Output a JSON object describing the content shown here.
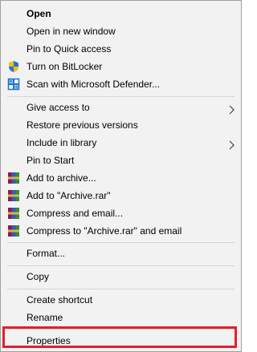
{
  "context_menu": {
    "items": [
      {
        "label": "Open",
        "bold": true
      },
      {
        "label": "Open in new window"
      },
      {
        "label": "Pin to Quick access"
      },
      {
        "label": "Turn on BitLocker",
        "icon": "shield-icon"
      },
      {
        "label": "Scan with Microsoft Defender...",
        "icon": "defender-icon"
      },
      {
        "label": "Give access to",
        "submenu": true
      },
      {
        "label": "Restore previous versions"
      },
      {
        "label": "Include in library",
        "submenu": true
      },
      {
        "label": "Pin to Start"
      },
      {
        "label": "Add to archive...",
        "icon": "winrar-icon"
      },
      {
        "label": "Add to \"Archive.rar\"",
        "icon": "winrar-icon"
      },
      {
        "label": "Compress and email...",
        "icon": "winrar-icon"
      },
      {
        "label": "Compress to \"Archive.rar\" and email",
        "icon": "winrar-icon"
      },
      {
        "label": "Format..."
      },
      {
        "label": "Copy"
      },
      {
        "label": "Create shortcut"
      },
      {
        "label": "Rename"
      },
      {
        "label": "Properties",
        "highlighted": true
      }
    ]
  },
  "colors": {
    "menu_background": "#f2f2f2",
    "separator": "#d4d4d4",
    "highlight_border": "#e0202f",
    "text": "#000000"
  }
}
